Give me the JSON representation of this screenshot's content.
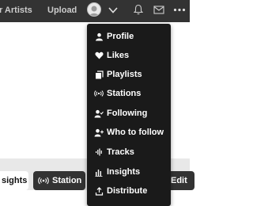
{
  "header": {
    "nav_artists": "r Artists",
    "nav_upload": "Upload",
    "icons": [
      "avatar",
      "chevron-down-icon",
      "bell-icon",
      "mail-icon",
      "more-icon"
    ]
  },
  "user_menu": {
    "items": [
      {
        "label": "Profile",
        "icon": "person-icon"
      },
      {
        "label": "Likes",
        "icon": "heart-icon"
      },
      {
        "label": "Playlists",
        "icon": "playlists-icon"
      },
      {
        "label": "Stations",
        "icon": "station-icon"
      },
      {
        "label": "Following",
        "icon": "following-icon"
      },
      {
        "label": "Who to follow",
        "icon": "who-to-follow-icon"
      },
      {
        "label": "Tracks",
        "icon": "waveform-icon"
      },
      {
        "label": "Insights",
        "icon": "insights-icon"
      },
      {
        "label": "Distribute",
        "icon": "distribute-icon"
      }
    ]
  },
  "actions": {
    "insights_label": "sights",
    "station_label": "Station",
    "edit_label": "Edit"
  },
  "colors": {
    "topbar": "#333333",
    "menu_bg": "#1a1a1a",
    "menu_text": "#ffffff"
  }
}
